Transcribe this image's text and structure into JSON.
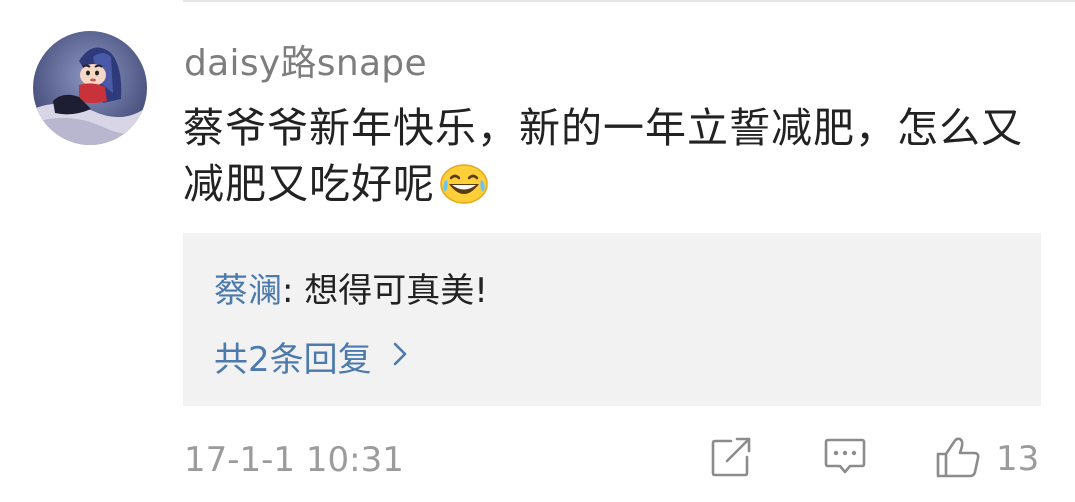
{
  "comment": {
    "username": "daisy路snape",
    "text": "蔡爷爷新年快乐，新的一年立誓减肥，怎么又减肥又吃好呢",
    "emoji": "laughing-tears-emoji",
    "timestamp": "17-1-1 10:31",
    "like_count": "13"
  },
  "reply": {
    "author": "蔡澜",
    "separator": ": ",
    "text": "想得可真美!",
    "more_replies": "共2条回复"
  },
  "icons": {
    "share": "share-icon",
    "comment": "comment-icon",
    "like": "thumbs-up-icon",
    "chevron": "chevron-right-icon"
  },
  "colors": {
    "link": "#4d7aac",
    "meta": "#9b9b9b",
    "text": "#222222",
    "reply_bg": "#f2f2f2"
  }
}
